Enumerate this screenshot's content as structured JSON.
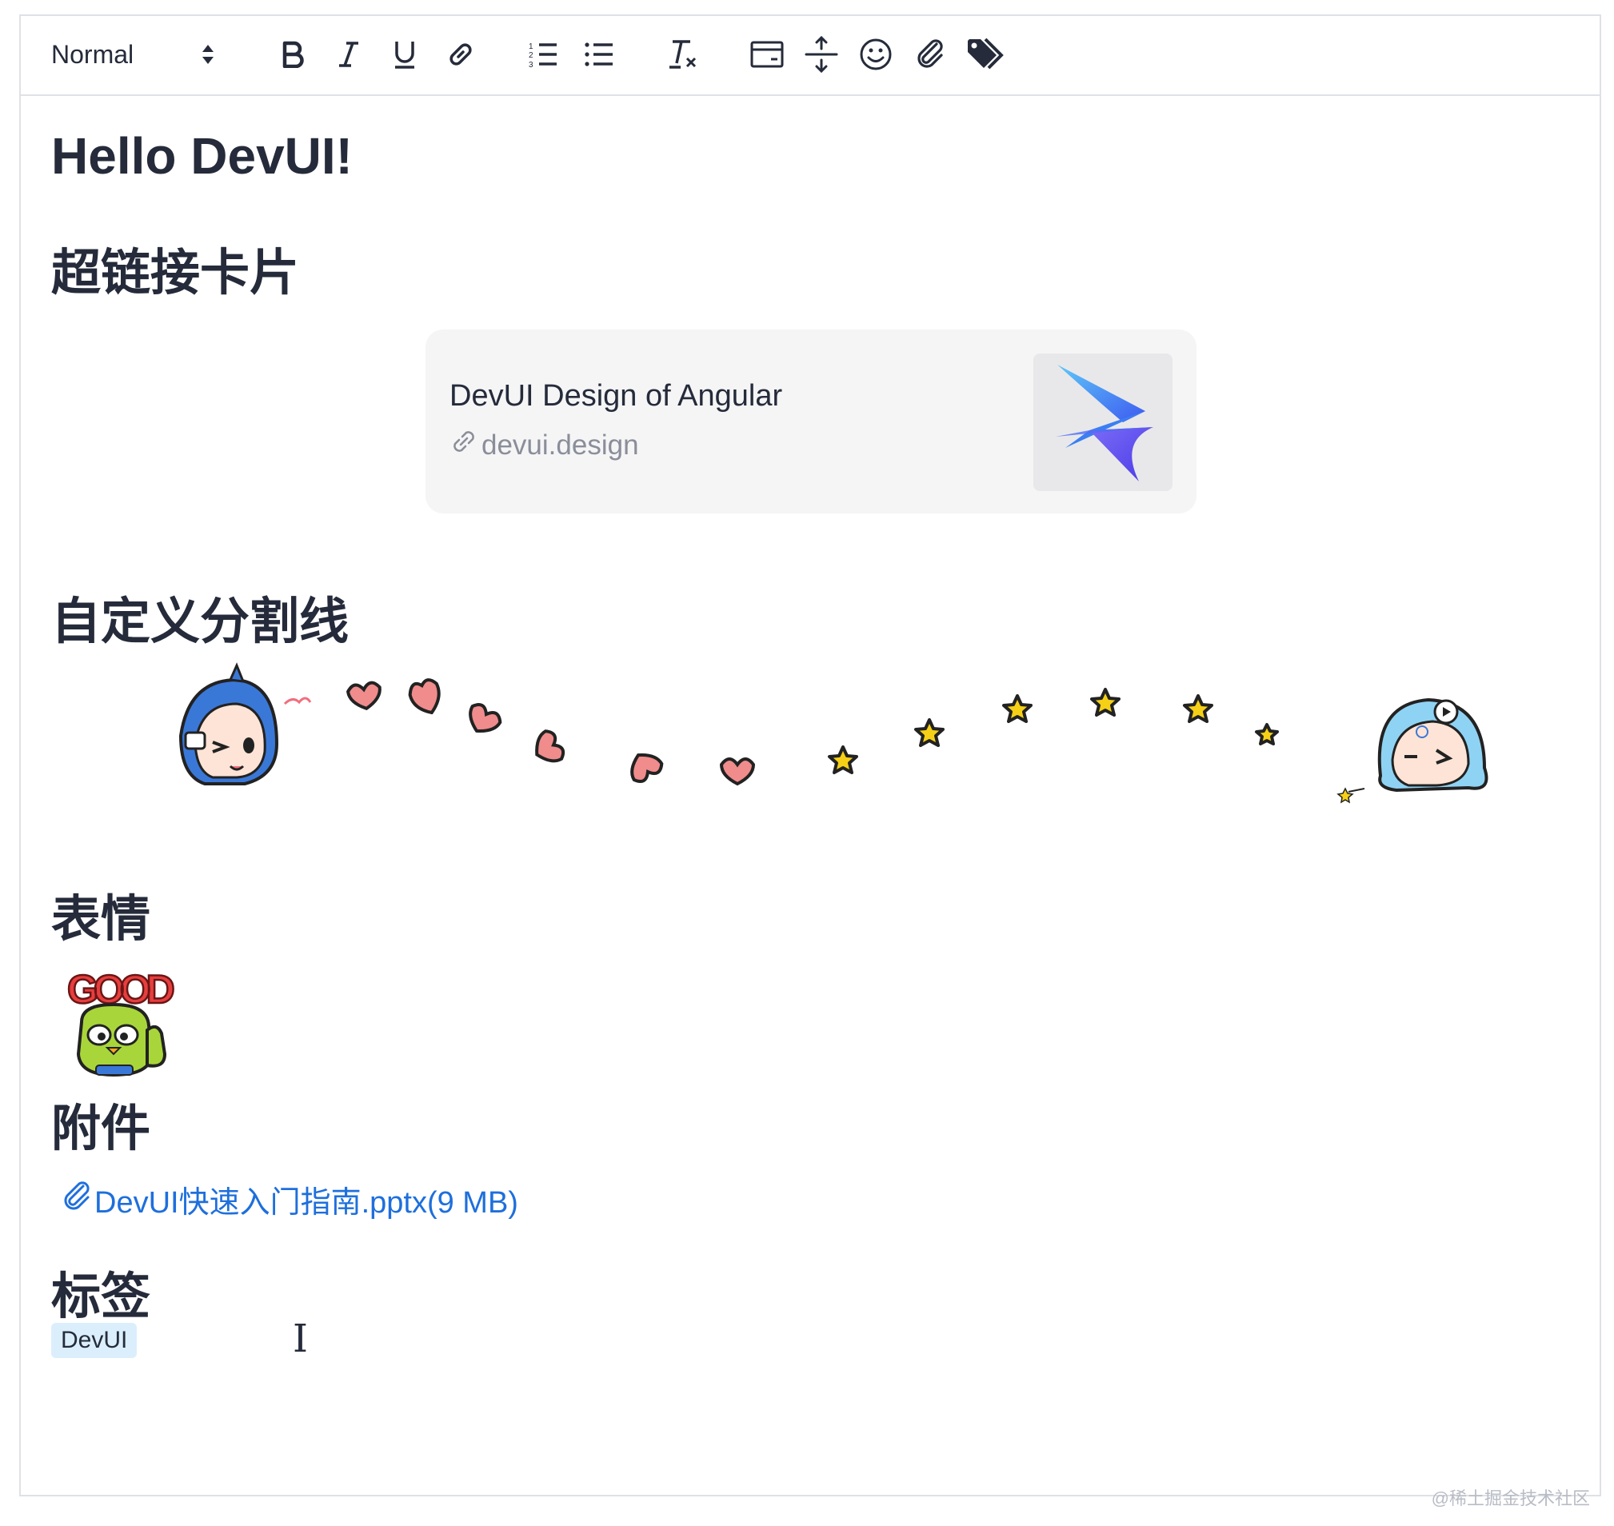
{
  "toolbar": {
    "format_value": "Normal",
    "buttons": [
      {
        "name": "bold-icon"
      },
      {
        "name": "italic-icon"
      },
      {
        "name": "underline-icon"
      },
      {
        "name": "link-icon"
      },
      {
        "name": "ordered-list-icon"
      },
      {
        "name": "bullet-list-icon"
      },
      {
        "name": "clear-format-icon"
      },
      {
        "name": "link-card-icon"
      },
      {
        "name": "divider-icon"
      },
      {
        "name": "emoji-icon"
      },
      {
        "name": "attachment-icon"
      },
      {
        "name": "tag-icon"
      }
    ]
  },
  "content": {
    "title": "Hello DevUI!",
    "section_link_card": "超链接卡片",
    "link_card": {
      "title": "DevUI Design of Angular",
      "url": "devui.design",
      "logo": "devui-logo"
    },
    "section_divider": "自定义分割线",
    "section_emoji": "表情",
    "emoji_text": "GOOD",
    "section_attachment": "附件",
    "attachment": "DevUI快速入门指南.pptx(9 MB)",
    "section_tag": "标签",
    "tag": "DevUI",
    "text_cursor": "I"
  },
  "watermark": "@稀土掘金技术社区",
  "colors": {
    "text": "#252b3a",
    "link": "#1e6fdc",
    "muted": "#8a8e99",
    "card_bg": "#f5f5f6",
    "tag_bg": "#dbeefc",
    "border": "#dfe1e6",
    "heart": "#f08c8c",
    "star": "#f5d016"
  }
}
